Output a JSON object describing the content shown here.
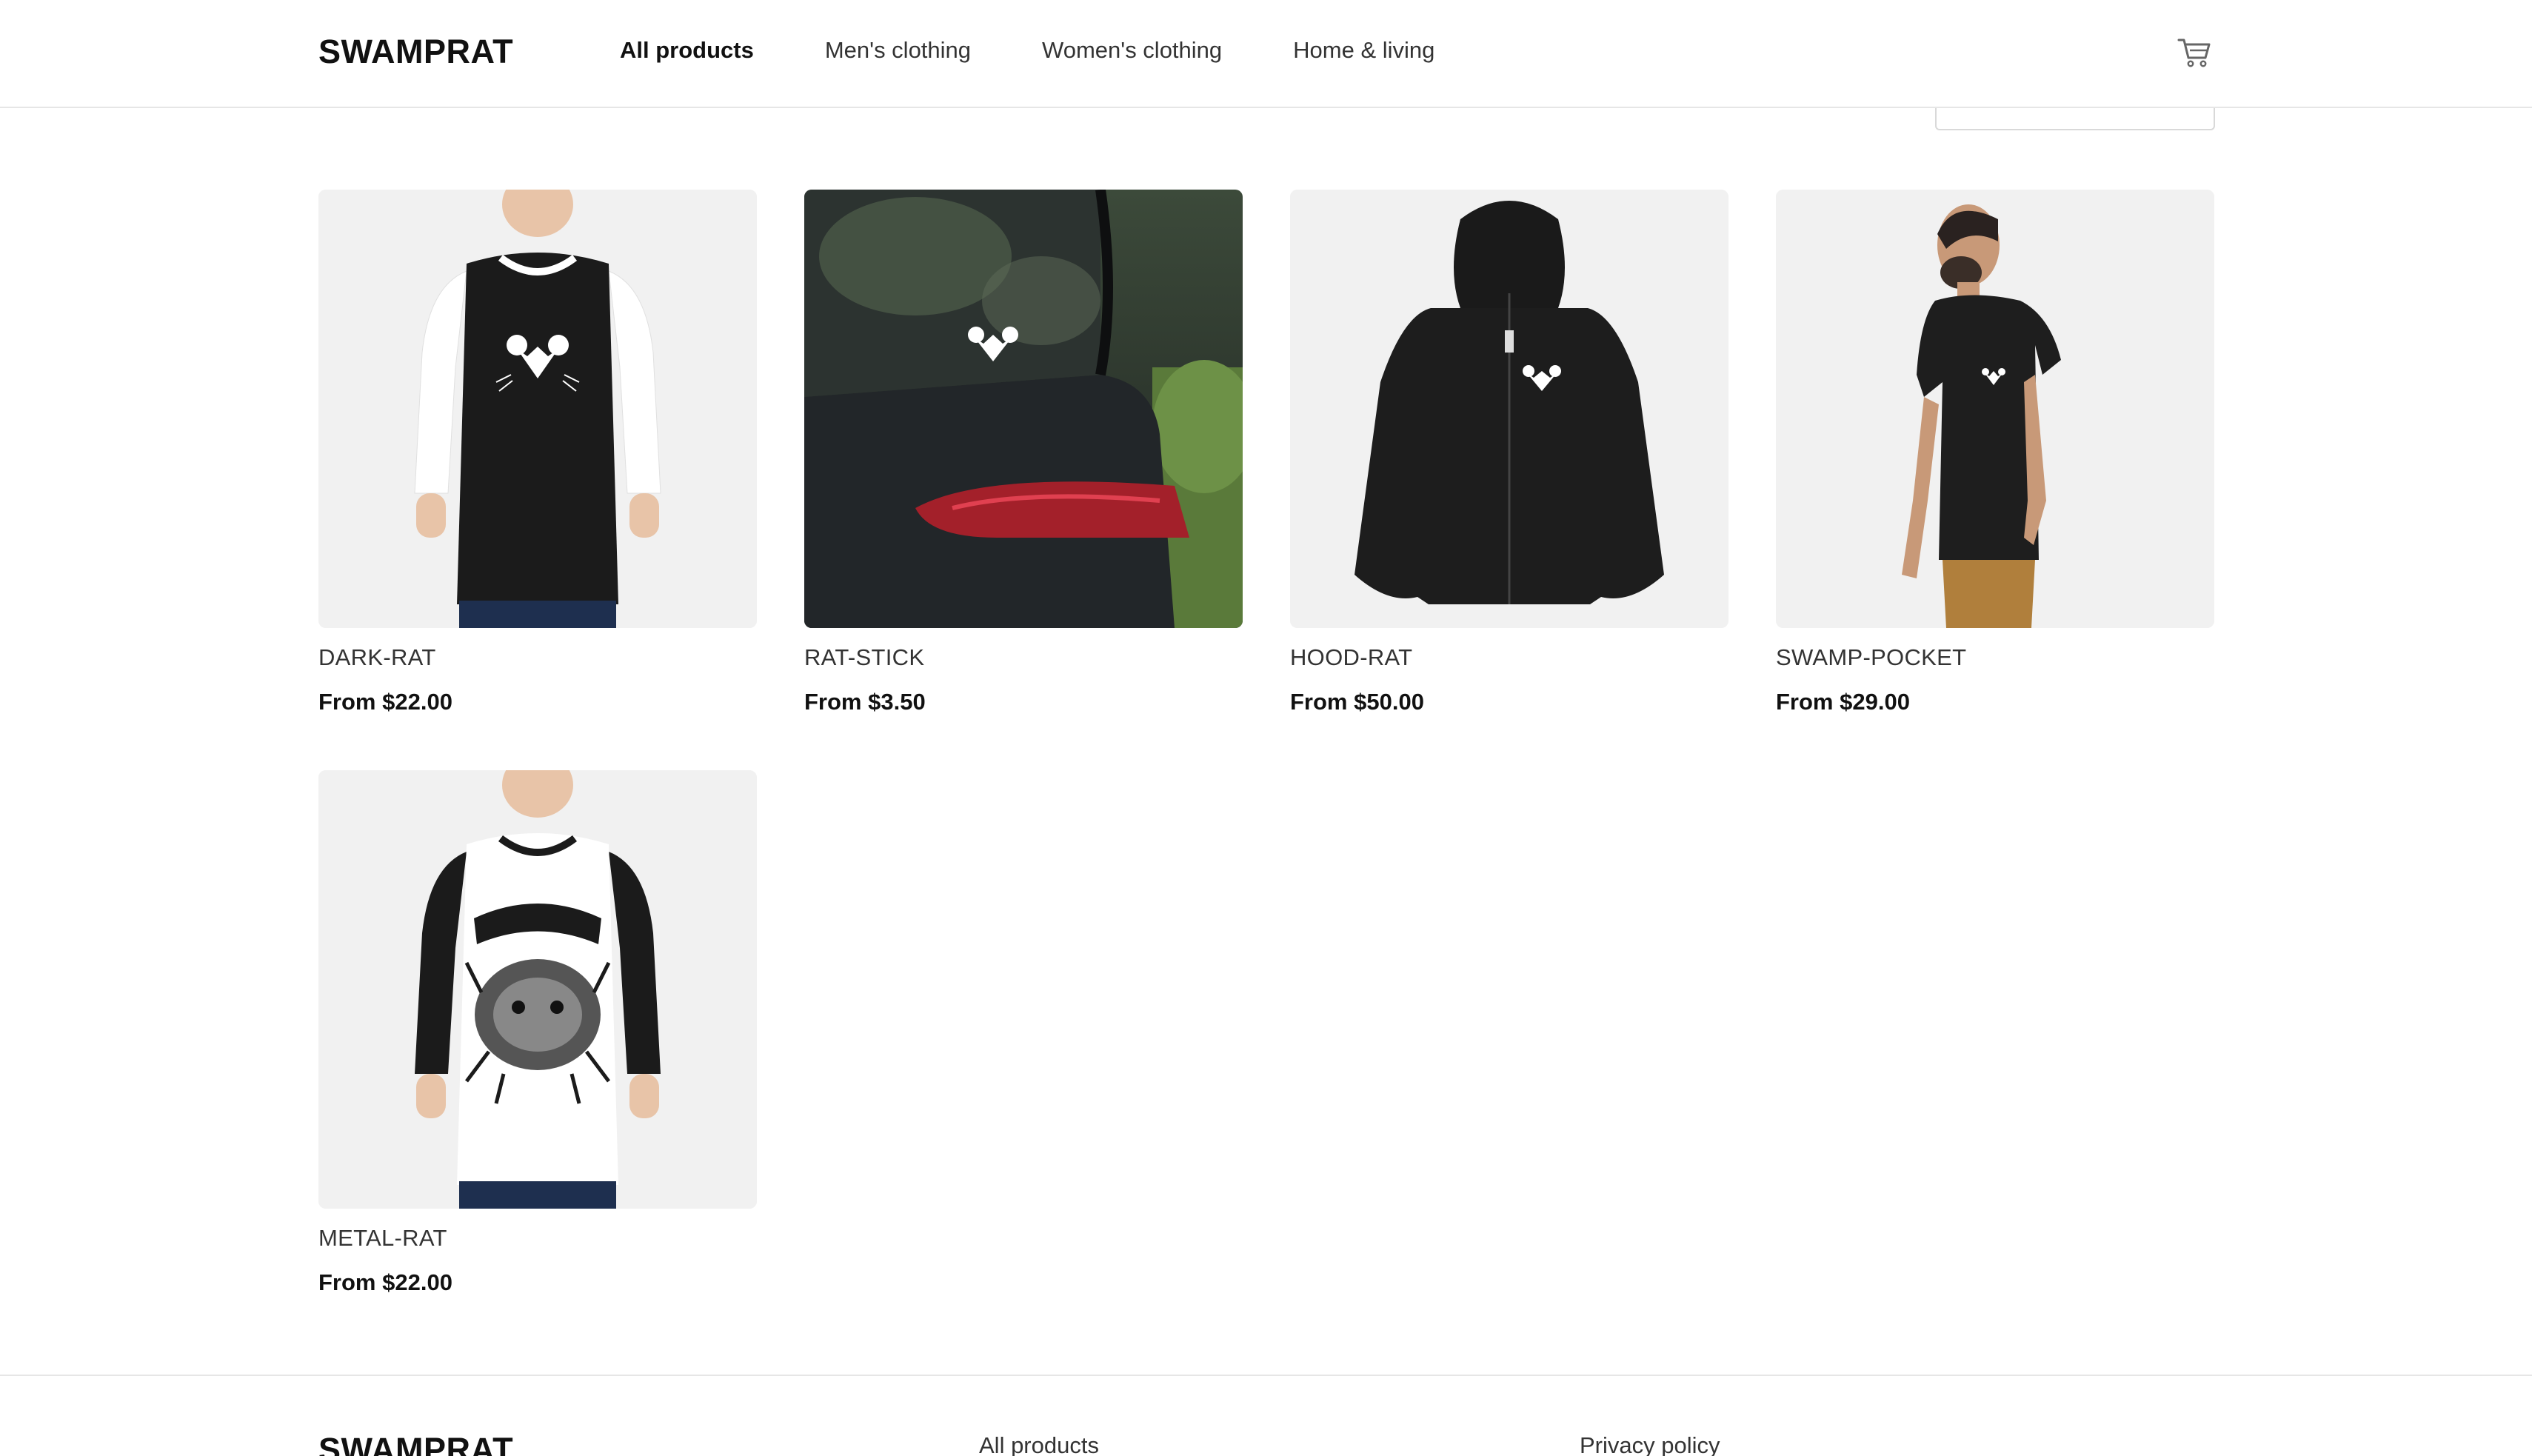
{
  "brand": {
    "name": "SWAMPRAT"
  },
  "nav": {
    "items": [
      {
        "label": "All products",
        "active": true
      },
      {
        "label": "Men's clothing",
        "active": false
      },
      {
        "label": "Women's clothing",
        "active": false
      },
      {
        "label": "Home & living",
        "active": false
      }
    ],
    "cart_icon": "shopping-cart-icon"
  },
  "products": [
    {
      "name": "DARK-RAT",
      "price": "From $22.00",
      "image": "raglan-tee-black-body-white-sleeves-rat-logo"
    },
    {
      "name": "RAT-STICK",
      "price": "From $3.50",
      "image": "rat-sticker-on-car-window"
    },
    {
      "name": "HOOD-RAT",
      "price": "From $50.00",
      "image": "black-zip-hoodie-rat-logo"
    },
    {
      "name": "SWAMP-POCKET",
      "price": "From $29.00",
      "image": "man-in-black-pocket-tee"
    },
    {
      "name": "METAL-RAT",
      "price": "From $22.00",
      "image": "raglan-tee-white-body-black-sleeves-metal-rat-print"
    }
  ],
  "footer": {
    "brand": "SWAMPRAT",
    "links": [
      "All products",
      "Privacy policy"
    ]
  },
  "colors": {
    "text": "#111111",
    "muted": "#333333",
    "border": "#e6e6e6",
    "image_bg": "#f1f1f1"
  }
}
